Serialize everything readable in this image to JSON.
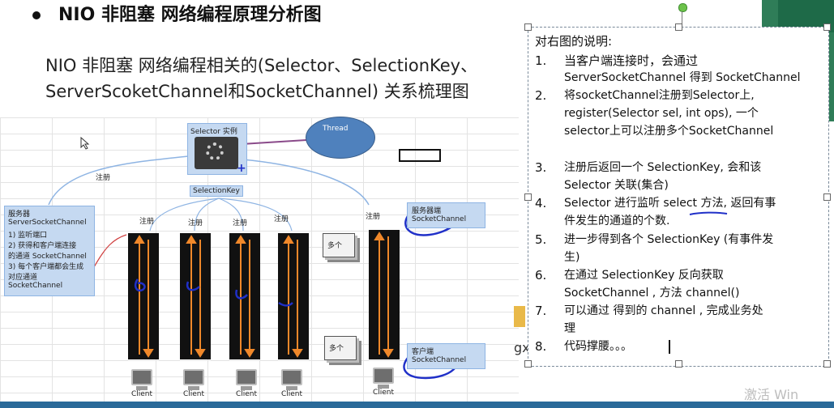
{
  "slide": {
    "heading": "NIO 非阻塞 网络编程原理分析图",
    "subtitle_line1": "NIO 非阻塞 网络编程相关的(Selector、SelectionKey、",
    "subtitle_line2": "ServerScoketChannel和SocketChannel) 关系梳理图"
  },
  "diagram": {
    "selector_title": "Selector 实例",
    "selection_key": "SelectionKey",
    "thread": "Thread",
    "register": "注册",
    "server_box": [
      "服务器",
      "ServerSocketChannel",
      "1) 监听端口",
      "2) 获得和客户端连接",
      "的通道 SocketChannel",
      "3) 每个客户端都会生成",
      "对应通道",
      "SocketChannel"
    ],
    "server_side_label": [
      "服务器端",
      "SocketChannel"
    ],
    "client_side_label": [
      "客户端",
      "SocketChannel"
    ],
    "many": "多个",
    "client": "Client"
  },
  "note": {
    "title": "对右图的说明:",
    "items": [
      {
        "num": "1.",
        "lines": [
          "当客户端连接时，会通过",
          "ServerSocketChannel 得到 SocketChannel"
        ]
      },
      {
        "num": "2.",
        "lines": [
          "将socketChannel注册到Selector上,",
          "register(Selector sel, int ops), 一个",
          "selector上可以注册多个SocketChannel"
        ]
      },
      {
        "num": "3.",
        "lines": [
          "注册后返回一个 SelectionKey, 会和该",
          "Selector 关联(集合)"
        ]
      },
      {
        "num": "4.",
        "lines": [
          "Selector 进行监听  select 方法, 返回有事",
          "件发生的通道的个数."
        ]
      },
      {
        "num": "5.",
        "lines": [
          "进一步得到各个 SelectionKey (有事件发",
          "生)"
        ]
      },
      {
        "num": "6.",
        "lines": [
          "在通过 SelectionKey  反向获取",
          "SocketChannel , 方法 channel()"
        ]
      },
      {
        "num": "7.",
        "lines": [
          "可以通过  得到的 channel , 完成业务处",
          "理"
        ]
      },
      {
        "num": "8.",
        "lines": [
          "代码撑腰。。。"
        ]
      }
    ]
  },
  "misc": {
    "gx": "gx",
    "watermark": "激活 Win"
  },
  "colors": {
    "accent_blue": "#2030c8",
    "arrow_orange": "#f0882a",
    "slide_green": "#2f7d58"
  }
}
